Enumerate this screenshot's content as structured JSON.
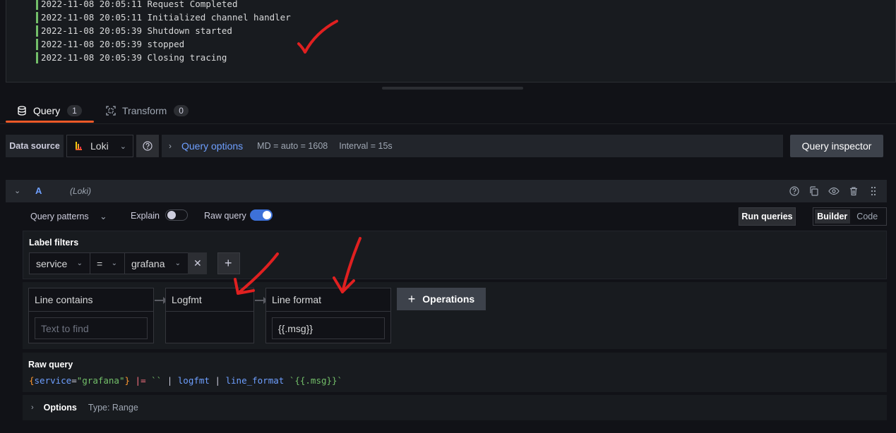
{
  "logs": [
    {
      "time": "2022-11-08 20:05:11",
      "msg": "Request Completed"
    },
    {
      "time": "2022-11-08 20:05:11",
      "msg": "Initialized channel handler"
    },
    {
      "time": "2022-11-08 20:05:39",
      "msg": "Shutdown started"
    },
    {
      "time": "2022-11-08 20:05:39",
      "msg": "stopped"
    },
    {
      "time": "2022-11-08 20:05:39",
      "msg": "Closing tracing"
    }
  ],
  "tabs": {
    "query": {
      "label": "Query",
      "count": "1"
    },
    "transform": {
      "label": "Transform",
      "count": "0"
    }
  },
  "toolbar": {
    "datasource_label": "Data source",
    "datasource_value": "Loki",
    "query_options_label": "Query options",
    "md": "MD = auto = 1608",
    "interval": "Interval = 15s",
    "query_inspector": "Query inspector"
  },
  "query": {
    "name": "A",
    "datasource": "(Loki)",
    "patterns_label": "Query patterns",
    "explain_label": "Explain",
    "explain_on": false,
    "raw_query_label": "Raw query",
    "raw_query_on": true,
    "run_label": "Run queries",
    "mode_builder": "Builder",
    "mode_code": "Code",
    "mode_active": "Builder"
  },
  "label_filters": {
    "title": "Label filters",
    "label": "service",
    "operator": "=",
    "value": "grafana"
  },
  "operations": {
    "items": [
      {
        "name": "Line contains",
        "placeholder": "Text to find",
        "value": ""
      },
      {
        "name": "Logfmt"
      },
      {
        "name": "Line format",
        "value": "{{.msg}}"
      }
    ],
    "add_label": "Operations"
  },
  "raw_query": {
    "title": "Raw query",
    "tokens": [
      {
        "text": "{",
        "color": "#ff9830"
      },
      {
        "text": "service",
        "color": "#6e9fff"
      },
      {
        "text": "=",
        "color": "#ccccdc"
      },
      {
        "text": "\"grafana\"",
        "color": "#73bf69"
      },
      {
        "text": "}",
        "color": "#ff9830"
      },
      {
        "text": " |= ",
        "color": "#ff7383"
      },
      {
        "text": "``",
        "color": "#73bf69"
      },
      {
        "text": " | ",
        "color": "#ccccdc"
      },
      {
        "text": "logfmt",
        "color": "#6e9fff"
      },
      {
        "text": " | ",
        "color": "#ccccdc"
      },
      {
        "text": "line_format",
        "color": "#6e9fff"
      },
      {
        "text": " ",
        "color": "#ccccdc"
      },
      {
        "text": "`{{.msg}}`",
        "color": "#73bf69"
      }
    ]
  },
  "options": {
    "title": "Options",
    "meta": "Type: Range"
  },
  "colors": {
    "accent": "#f05a28",
    "link": "#6e9fff",
    "annotation": "#e02020"
  }
}
